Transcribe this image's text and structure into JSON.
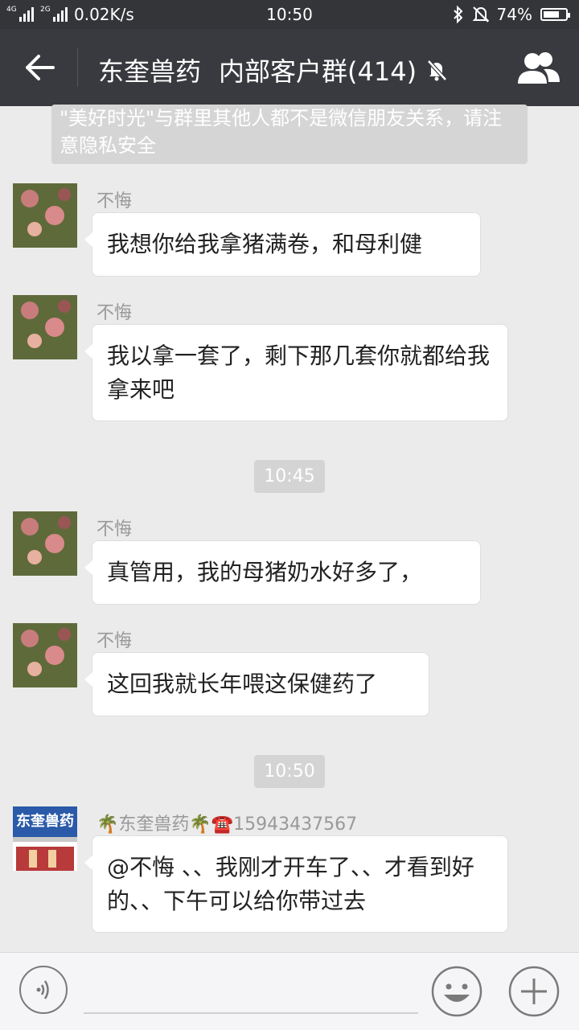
{
  "status": {
    "network1": "4G",
    "network2": "4G",
    "network3": "2G",
    "speed": "0.02K/s",
    "time": "10:50",
    "battery": "74%",
    "battery_level": 0.74
  },
  "header": {
    "title_name": "东奎兽药",
    "title_group": "内部客户群(414)"
  },
  "notice": "\"美好时光\"与群里其他人都不是微信朋友关系，请注意隐私安全",
  "messages": [
    {
      "sender": "不悔",
      "text": "我想你给我拿猪满卷，和母利健"
    },
    {
      "sender": "不悔",
      "text": "我以拿一套了，剩下那几套你就都给我拿来吧"
    },
    {
      "sender": "不悔",
      "text": "真管用，我的母猪奶水好多了，"
    },
    {
      "sender": "不悔",
      "text": "这回我就长年喂这保健药了"
    },
    {
      "sender": "🌴东奎兽药🌴☎️15943437567",
      "text": "@不悔 、、我刚才开车了、、才看到好的、、下午可以给你带过去"
    }
  ],
  "timestamps": [
    "10:45",
    "10:50"
  ],
  "avatar2_sign": "东奎兽药",
  "colors": {
    "header_bg": "#393a3f",
    "chat_bg": "#ebebeb",
    "bubble_bg": "#ffffff"
  },
  "icons": [
    "back-arrow-icon",
    "mute-bell-icon",
    "group-members-icon",
    "voice-icon",
    "emoji-icon",
    "plus-icon"
  ]
}
